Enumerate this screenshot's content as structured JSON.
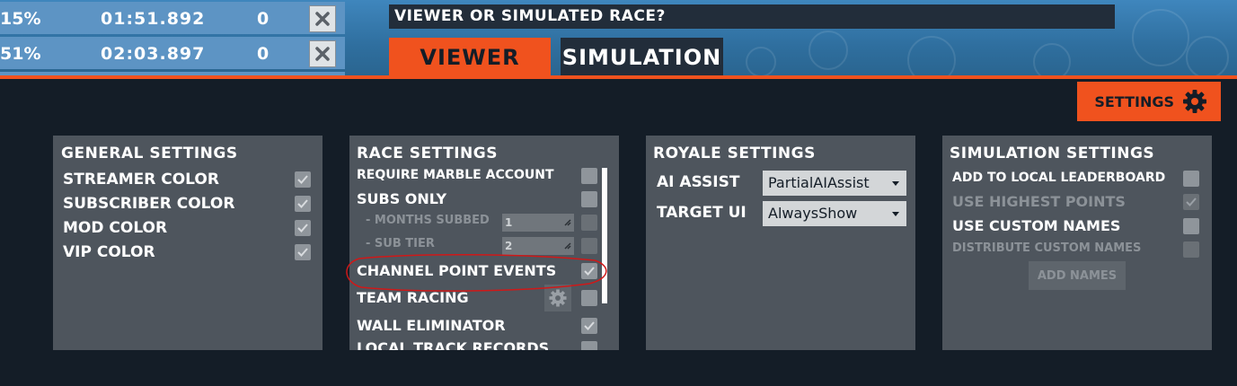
{
  "leaderboard": [
    {
      "percent": "15%",
      "time": "01:51.892",
      "count": "0"
    },
    {
      "percent": "51%",
      "time": "02:03.897",
      "count": "0"
    }
  ],
  "question": "VIEWER OR SIMULATED RACE?",
  "tabs": {
    "viewer": "VIEWER",
    "simulation": "SIMULATION"
  },
  "settings_button": "SETTINGS",
  "general": {
    "title": "GENERAL SETTINGS",
    "items": [
      {
        "label": "STREAMER COLOR",
        "checked": true
      },
      {
        "label": "SUBSCRIBER COLOR",
        "checked": true
      },
      {
        "label": "MOD COLOR",
        "checked": true
      },
      {
        "label": "VIP COLOR",
        "checked": true
      }
    ]
  },
  "race": {
    "title": "RACE SETTINGS",
    "require_marble": "REQUIRE MARBLE ACCOUNT",
    "subs_only": "SUBS ONLY",
    "months_subbed": "- MONTHS SUBBED",
    "months_value": "1",
    "sub_tier": "- SUB TIER",
    "sub_tier_value": "2",
    "channel_points": "CHANNEL POINT EVENTS",
    "team_racing": "TEAM RACING",
    "wall_eliminator": "WALL ELIMINATOR",
    "local_track_records": "LOCAL TRACK RECORDS"
  },
  "royale": {
    "title": "ROYALE SETTINGS",
    "ai_assist_label": "AI ASSIST",
    "ai_assist_value": "PartialAIAssist",
    "target_ui_label": "TARGET UI",
    "target_ui_value": "AlwaysShow"
  },
  "simulation": {
    "title": "SIMULATION SETTINGS",
    "add_local": "ADD TO LOCAL LEADERBOARD",
    "use_highest": "USE HIGHEST POINTS",
    "use_custom": "USE CUSTOM NAMES",
    "distribute_custom": "DISTRIBUTE CUSTOM NAMES",
    "add_names": "ADD NAMES"
  },
  "colors": {
    "accent": "#f0521e",
    "background": "#141d27",
    "panel": "#4e555d",
    "annotation": "#d01818"
  }
}
